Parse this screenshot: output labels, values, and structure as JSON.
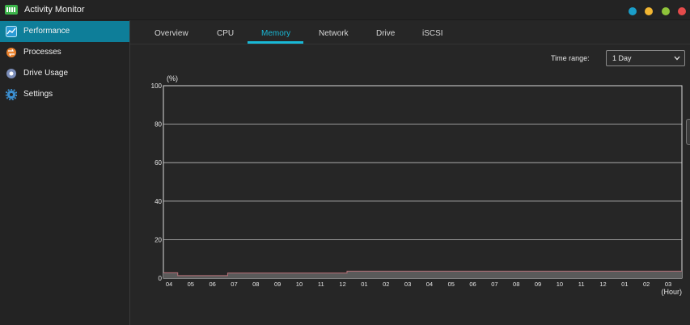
{
  "window": {
    "title": "Activity Monitor",
    "logo_icon": "activity-monitor-logo-icon"
  },
  "window_controls": [
    {
      "name": "window-dot-blue",
      "color": "#1a9ec9"
    },
    {
      "name": "window-dot-yellow",
      "color": "#f2b632"
    },
    {
      "name": "window-dot-green",
      "color": "#8fc43a"
    },
    {
      "name": "window-dot-red",
      "color": "#e54b4b"
    }
  ],
  "sidebar": {
    "items": [
      {
        "label": "Performance",
        "icon": "performance-chart-icon",
        "active": true
      },
      {
        "label": "Processes",
        "icon": "processes-icon",
        "active": false
      },
      {
        "label": "Drive Usage",
        "icon": "drive-usage-icon",
        "active": false
      },
      {
        "label": "Settings",
        "icon": "settings-gear-icon",
        "active": false
      }
    ]
  },
  "tabs": [
    {
      "label": "Overview",
      "active": false
    },
    {
      "label": "CPU",
      "active": false
    },
    {
      "label": "Memory",
      "active": true
    },
    {
      "label": "Network",
      "active": false
    },
    {
      "label": "Drive",
      "active": false
    },
    {
      "label": "iSCSI",
      "active": false
    }
  ],
  "time_range": {
    "label": "Time range:",
    "value": "1 Day"
  },
  "colors": {
    "accent": "#19b8d6",
    "active_sidebar": "#0e7e99",
    "series_line": "#b9727a",
    "series_fill": "#5a5a5a"
  },
  "chart_data": {
    "type": "area",
    "ylabel": "(%)",
    "xlabel": "(Hour)",
    "ylim": [
      0,
      100
    ],
    "yticks": [
      0,
      20,
      40,
      60,
      80,
      100
    ],
    "grid": true,
    "categories": [
      "04",
      "05",
      "06",
      "07",
      "08",
      "09",
      "10",
      "11",
      "12",
      "01",
      "02",
      "03",
      "04",
      "05",
      "06",
      "07",
      "08",
      "09",
      "10",
      "11",
      "12",
      "01",
      "02",
      "03"
    ],
    "series": [
      {
        "x": [
          0,
          0.2,
          0.4,
          1.0,
          2.0,
          2.6,
          2.7,
          3.0,
          4.0,
          5.0,
          6.0,
          7.0,
          8.0,
          8.2,
          9.0,
          10.0,
          12.0,
          14.0,
          16.0,
          18.0,
          20.0,
          22.0,
          23.0,
          23.5
        ],
        "values": [
          2.8,
          2.8,
          1.3,
          1.3,
          1.3,
          1.3,
          2.6,
          2.6,
          2.6,
          2.6,
          2.6,
          2.6,
          2.6,
          3.6,
          3.6,
          3.6,
          3.6,
          3.6,
          3.6,
          3.6,
          3.6,
          3.6,
          3.6,
          3.6
        ]
      }
    ]
  }
}
